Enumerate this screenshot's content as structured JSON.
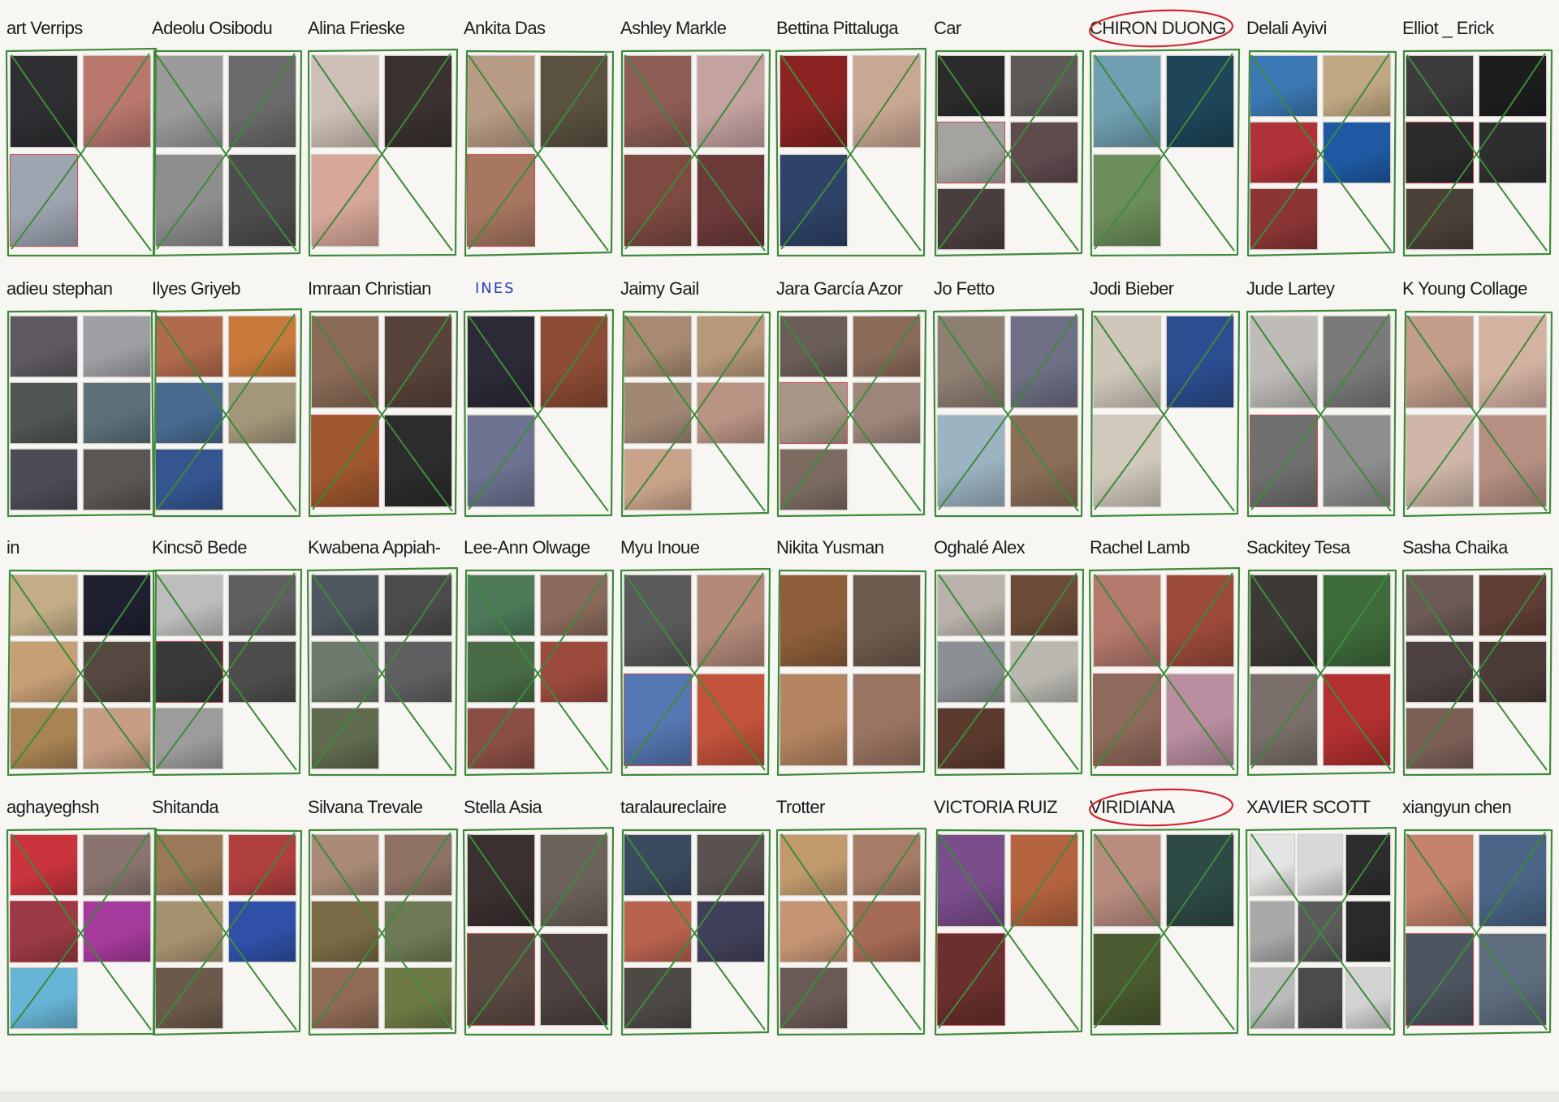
{
  "sheet": {
    "rows": [
      [
        {
          "name": "art Verrips",
          "thumbs": [
            "#2f2f33",
            "#b9776e",
            "#9da5b1"
          ],
          "crossed": true
        },
        {
          "name": "Adeolu Osibodu",
          "thumbs": [
            "#9b9b9b",
            "#6b6b6b",
            "#8e8e8e",
            "#4d4d4d"
          ],
          "crossed": true
        },
        {
          "name": "Alina  Frieske",
          "thumbs": [
            "#cdbfb5",
            "#3a3231",
            "#d7a79a"
          ],
          "crossed": true
        },
        {
          "name": "Ankita Das",
          "thumbs": [
            "#b89c85",
            "#5a5140",
            "#a77761"
          ],
          "crossed": true
        },
        {
          "name": "Ashley Markle",
          "thumbs": [
            "#8e5d55",
            "#c4a2a0",
            "#7e4a42",
            "#6d3a3a"
          ],
          "crossed": true
        },
        {
          "name": "Bettina Pittaluga",
          "thumbs": [
            "#8b2323",
            "#c9a893",
            "#2f4368"
          ],
          "crossed": true
        },
        {
          "name": "Car",
          "thumbs": [
            "#2b2b2b",
            "#5d5a57",
            "#a4a39f",
            "#5f4a4e",
            "#4a3d3d"
          ],
          "crossed": true
        },
        {
          "name": "CHIRON DUONG",
          "thumbs": [
            "#6f9fb1",
            "#1e4658",
            "#6c8e5a"
          ],
          "crossed": true,
          "circled": true
        },
        {
          "name": "Delali  Ayivi",
          "thumbs": [
            "#3b78b3",
            "#c0a882",
            "#b03238",
            "#1e5aa3",
            "#8b3535"
          ],
          "crossed": true
        },
        {
          "name": "Elliot _ Erick",
          "thumbs": [
            "#3c3c3c",
            "#1d1d1d",
            "#2b2b2b",
            "#2e2e2e",
            "#4a4038"
          ],
          "crossed": true
        }
      ],
      [
        {
          "name": "adieu stephan",
          "thumbs": [
            "#5f5a62",
            "#9e9fa3",
            "#4f5552",
            "#5b6f78",
            "#4b4c56",
            "#595653"
          ],
          "crossed": false
        },
        {
          "name": "Ilyes Griyeb",
          "thumbs": [
            "#b06a4c",
            "#c97a3b",
            "#486a8f",
            "#a3977a",
            "#34558f"
          ],
          "crossed": true
        },
        {
          "name": "Imraan Christian",
          "thumbs": [
            "#8b6a57",
            "#574339",
            "#a0582e",
            "#2c2c2c"
          ],
          "crossed": true
        },
        {
          "name": "INES",
          "hand": true,
          "thumbs": [
            "#2c2a36",
            "#8c4b34",
            "#6e7391"
          ],
          "crossed": true
        },
        {
          "name": "Jaimy Gail",
          "thumbs": [
            "#a78a71",
            "#b7987a",
            "#a18875",
            "#b99384",
            "#c8a38a"
          ],
          "crossed": true
        },
        {
          "name": "Jara García Azor",
          "thumbs": [
            "#6b5e58",
            "#8a6b5a",
            "#a89787",
            "#9d857a",
            "#7b6b61"
          ],
          "crossed": true
        },
        {
          "name": "Jo Fetto",
          "thumbs": [
            "#8d7f72",
            "#6f6f85",
            "#9cb3c2",
            "#8a6e58"
          ],
          "crossed": true
        },
        {
          "name": "Jodi Bieber",
          "thumbs": [
            "#cfc7ba",
            "#2c4d8f",
            "#d1c9bc"
          ],
          "crossed": true
        },
        {
          "name": "Jude Lartey",
          "thumbs": [
            "#bfbcb8",
            "#7a7a7a",
            "#707070",
            "#8e8e8e"
          ],
          "crossed": true
        },
        {
          "name": "K Young Collage",
          "thumbs": [
            "#c29d8a",
            "#d4b3a3",
            "#cfb6a9",
            "#b58f82"
          ],
          "crossed": true
        }
      ],
      [
        {
          "name": "in",
          "thumbs": [
            "#c2ad86",
            "#1f2030",
            "#c69f74",
            "#554840",
            "#a88354",
            "#c79d83"
          ],
          "crossed": true
        },
        {
          "name": "Kincsõ Bede",
          "thumbs": [
            "#bdbdbd",
            "#5f5f5f",
            "#3a3a3a",
            "#4d4d4d",
            "#9c9c9c"
          ],
          "crossed": true
        },
        {
          "name": "Kwabena Appiah-",
          "thumbs": [
            "#4f5860",
            "#4b4b4b",
            "#6e7a6d",
            "#5e5f61",
            "#5f6a4e"
          ],
          "crossed": true
        },
        {
          "name": "Lee-Ann Olwage",
          "thumbs": [
            "#4e7a5a",
            "#8a6a5c",
            "#496b46",
            "#9b4a3c",
            "#8a4e44"
          ],
          "crossed": true
        },
        {
          "name": "Myu Inoue",
          "thumbs": [
            "#5a5a5a",
            "#b38a7a",
            "#5577b3",
            "#c4533b"
          ],
          "crossed": true
        },
        {
          "name": "Nikita Yusman",
          "thumbs": [
            "#8e5f3a",
            "#6e5b4d",
            "#b58561",
            "#9a7462"
          ],
          "crossed": false
        },
        {
          "name": "Oghalé Alex",
          "thumbs": [
            "#b9b3ab",
            "#6b4a38",
            "#8b9094",
            "#b9b7b0",
            "#5b3a2e"
          ],
          "crossed": true
        },
        {
          "name": "Rachel Lamb",
          "thumbs": [
            "#b4786c",
            "#9c4a3a",
            "#8e6a5c",
            "#b88ea0"
          ],
          "crossed": true
        },
        {
          "name": "Sackitey Tesa",
          "thumbs": [
            "#3d3a35",
            "#3e6b3a",
            "#7a6f6a",
            "#b23030"
          ],
          "crossed": true
        },
        {
          "name": "Sasha Chaika",
          "thumbs": [
            "#6b5a55",
            "#5f3e35",
            "#4c4040",
            "#4b3c38",
            "#7b5f57"
          ],
          "crossed": true
        }
      ],
      [
        {
          "name": "aghayeghsh",
          "thumbs": [
            "#c9343d",
            "#8a7470",
            "#9b3a45",
            "#a63a9c",
            "#67b5d6"
          ],
          "crossed": true
        },
        {
          "name": "Shitanda",
          "thumbs": [
            "#9a7858",
            "#b03f3f",
            "#a6916e",
            "#3050a8",
            "#6b5a4b"
          ],
          "crossed": true
        },
        {
          "name": "Silvana Trevale",
          "thumbs": [
            "#a88a77",
            "#8e7364",
            "#7a6a45",
            "#6d7a55",
            "#8f6a55",
            "#6d7a45"
          ],
          "crossed": true
        },
        {
          "name": "Stella Asia",
          "thumbs": [
            "#3a3030",
            "#6b635a",
            "#5a4a42",
            "#4d4240"
          ],
          "crossed": true
        },
        {
          "name": "taralaureclaire",
          "thumbs": [
            "#3b4b5f",
            "#5a5250",
            "#b9624f",
            "#41405a",
            "#4d4a46"
          ],
          "crossed": true
        },
        {
          "name": "Trotter",
          "thumbs": [
            "#c09a6d",
            "#a77c66",
            "#c49474",
            "#a56a55",
            "#6a5a55"
          ],
          "crossed": true
        },
        {
          "name": "VICTORIA RUIZ",
          "thumbs": [
            "#7a4d8b",
            "#b5633e",
            "#6a2f2e"
          ],
          "crossed": true
        },
        {
          "name": "VIRIDIANA",
          "thumbs": [
            "#b98c80",
            "#2e4a45",
            "#4b5a30"
          ],
          "crossed": true,
          "circled": true
        },
        {
          "name": "XAVIER SCOTT",
          "thumbs": [
            "#e4e4e4",
            "#d8d8d8",
            "#2d2d2d",
            "#a9a9a9",
            "#5b5b5b",
            "#2a2a2a",
            "#bcbcbc",
            "#4b4b4b",
            "#d2d2d2"
          ],
          "crossed": true
        },
        {
          "name": "xiangyun chen",
          "thumbs": [
            "#c4826b",
            "#4a6585",
            "#4d5560",
            "#5e6d7e"
          ],
          "crossed": true
        }
      ]
    ],
    "ink_colors": {
      "cross": "#3f8a3b",
      "circle": "#cf2a32",
      "hand": "#2a3fb8"
    }
  }
}
